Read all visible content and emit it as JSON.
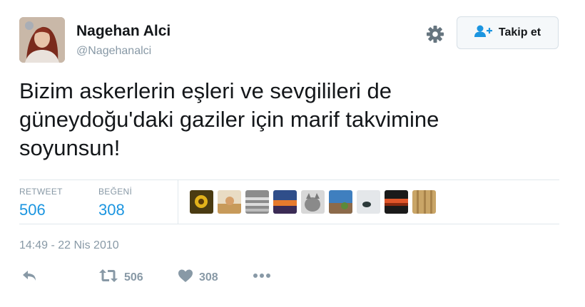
{
  "author": {
    "name": "Nagehan Alci",
    "handle": "@Nagehanalci"
  },
  "header": {
    "follow_label": "Takip et",
    "icons": [
      "gear-icon",
      "follow-person-icon"
    ]
  },
  "tweet": {
    "text": "Bizim askerlerin eşleri ve sevgilileri de\ngüneydoğu'daki gaziler için marif takvimine\nsoyunsun!",
    "timestamp": "14:49 - 22 Nis 2010"
  },
  "stats": {
    "retweet_label": "RETWEET",
    "retweet_count": "506",
    "like_label": "BEĞENİ",
    "like_count": "308"
  },
  "likers": [
    "liker-1",
    "liker-2",
    "liker-3",
    "liker-4",
    "liker-5",
    "liker-6",
    "liker-7",
    "liker-8",
    "liker-9"
  ],
  "actions": {
    "retweet_count": "506",
    "like_count": "308",
    "icons": [
      "reply-icon",
      "retweet-icon",
      "heart-icon",
      "more-icon"
    ]
  },
  "colors": {
    "accent": "#1b95e0",
    "muted": "#8899a6",
    "divider": "#e1e8ed"
  }
}
